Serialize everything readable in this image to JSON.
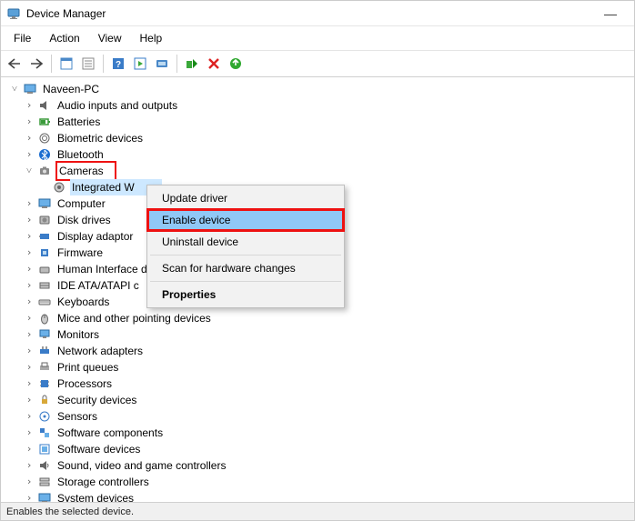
{
  "window": {
    "title": "Device Manager",
    "minimize": "—"
  },
  "menu": [
    "File",
    "Action",
    "View",
    "Help"
  ],
  "tree": {
    "root": "Naveen-PC",
    "items": [
      "Audio inputs and outputs",
      "Batteries",
      "Biometric devices",
      "Bluetooth",
      "Cameras",
      "Computer",
      "Disk drives",
      "Display adaptor",
      "Firmware",
      "Human Interface d",
      "IDE ATA/ATAPI c",
      "Keyboards",
      "Mice and other pointing devices",
      "Monitors",
      "Network adapters",
      "Print queues",
      "Processors",
      "Security devices",
      "Sensors",
      "Software components",
      "Software devices",
      "Sound, video and game controllers",
      "Storage controllers",
      "System devices"
    ],
    "camera_child": "Integrated W"
  },
  "context_menu": {
    "items": [
      "Update driver",
      "Enable device",
      "Uninstall device",
      "Scan for hardware changes",
      "Properties"
    ],
    "selected_index": 1,
    "bold_index": 4
  },
  "status": "Enables the selected device."
}
